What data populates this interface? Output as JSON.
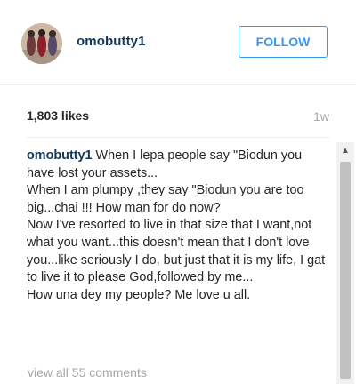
{
  "header": {
    "username": "omobutty1",
    "follow_label": "FOLLOW"
  },
  "stats": {
    "likes": "1,803 likes",
    "timestamp": "1w"
  },
  "caption": {
    "username": "omobutty1",
    "text": " When I lepa people say \"Biodun you have lost your assets...\nWhen I am plumpy ,they say \"Biodun you are too big...chai !!! How man for do now?\nNow I've resorted to live in that size that I want,not what you want...this doesn't mean that I don't love you...like seriously I do, but just that it is my life, I gat to live it to please God,followed by me...\nHow una dey my people? Me love u all."
  },
  "comments": {
    "view_all_label": "view all 55 comments"
  },
  "icons": {
    "avatar": "profile-photo",
    "scroll_up": "chevron-up-icon"
  },
  "colors": {
    "username": "#12375c",
    "follow": "#3897f0",
    "muted": "#a5a7aa"
  }
}
